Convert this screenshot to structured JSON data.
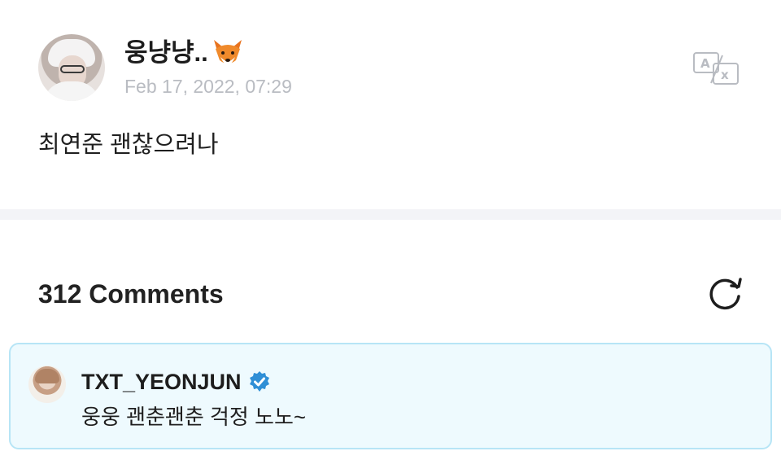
{
  "post": {
    "author_name": "웅냥냥..",
    "author_emoji_icon": "fox-face-icon",
    "date": "Feb 17, 2022, 07:29",
    "body": "최연준 괜찮으려나",
    "translate_icon": "translate-icon"
  },
  "comments": {
    "title": "312 Comments",
    "refresh_icon": "refresh-icon",
    "artist_comment": {
      "author": "TXT_YEONJUN",
      "verified_icon": "verified-badge-icon",
      "text": "웅웅 괜춘괜춘 걱정 노노~"
    }
  },
  "colors": {
    "highlight_bg": "#eefafe",
    "highlight_border": "#b7e5f6",
    "verified": "#2f8fd6",
    "date": "#b9bcc2",
    "separator": "#f3f4f7"
  }
}
